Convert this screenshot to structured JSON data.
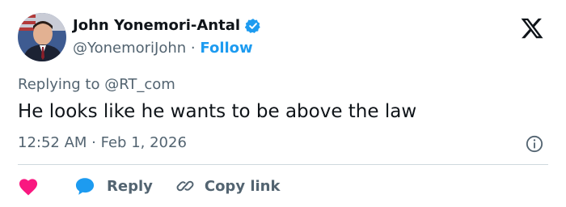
{
  "tweet": {
    "author_name": "John Yonemori-Antal",
    "handle": "@YonemoriJohn",
    "separator": "·",
    "follow_label": "Follow",
    "replying_to": "Replying to @RT_com",
    "text": "He looks like he wants to be above the law",
    "timestamp": "12:52 AM · Feb 1, 2026"
  },
  "actions": {
    "reply_label": "Reply",
    "copy_link_label": "Copy link"
  },
  "colors": {
    "accent": "#1d9bf0",
    "heart": "#f91880",
    "text_primary": "#0f1419",
    "text_secondary": "#536471"
  },
  "icons": {
    "verified": "verified-badge-icon",
    "logo": "x-logo-icon",
    "info": "info-icon",
    "like": "heart-icon",
    "reply": "speech-bubble-icon",
    "copy_link": "link-icon"
  }
}
